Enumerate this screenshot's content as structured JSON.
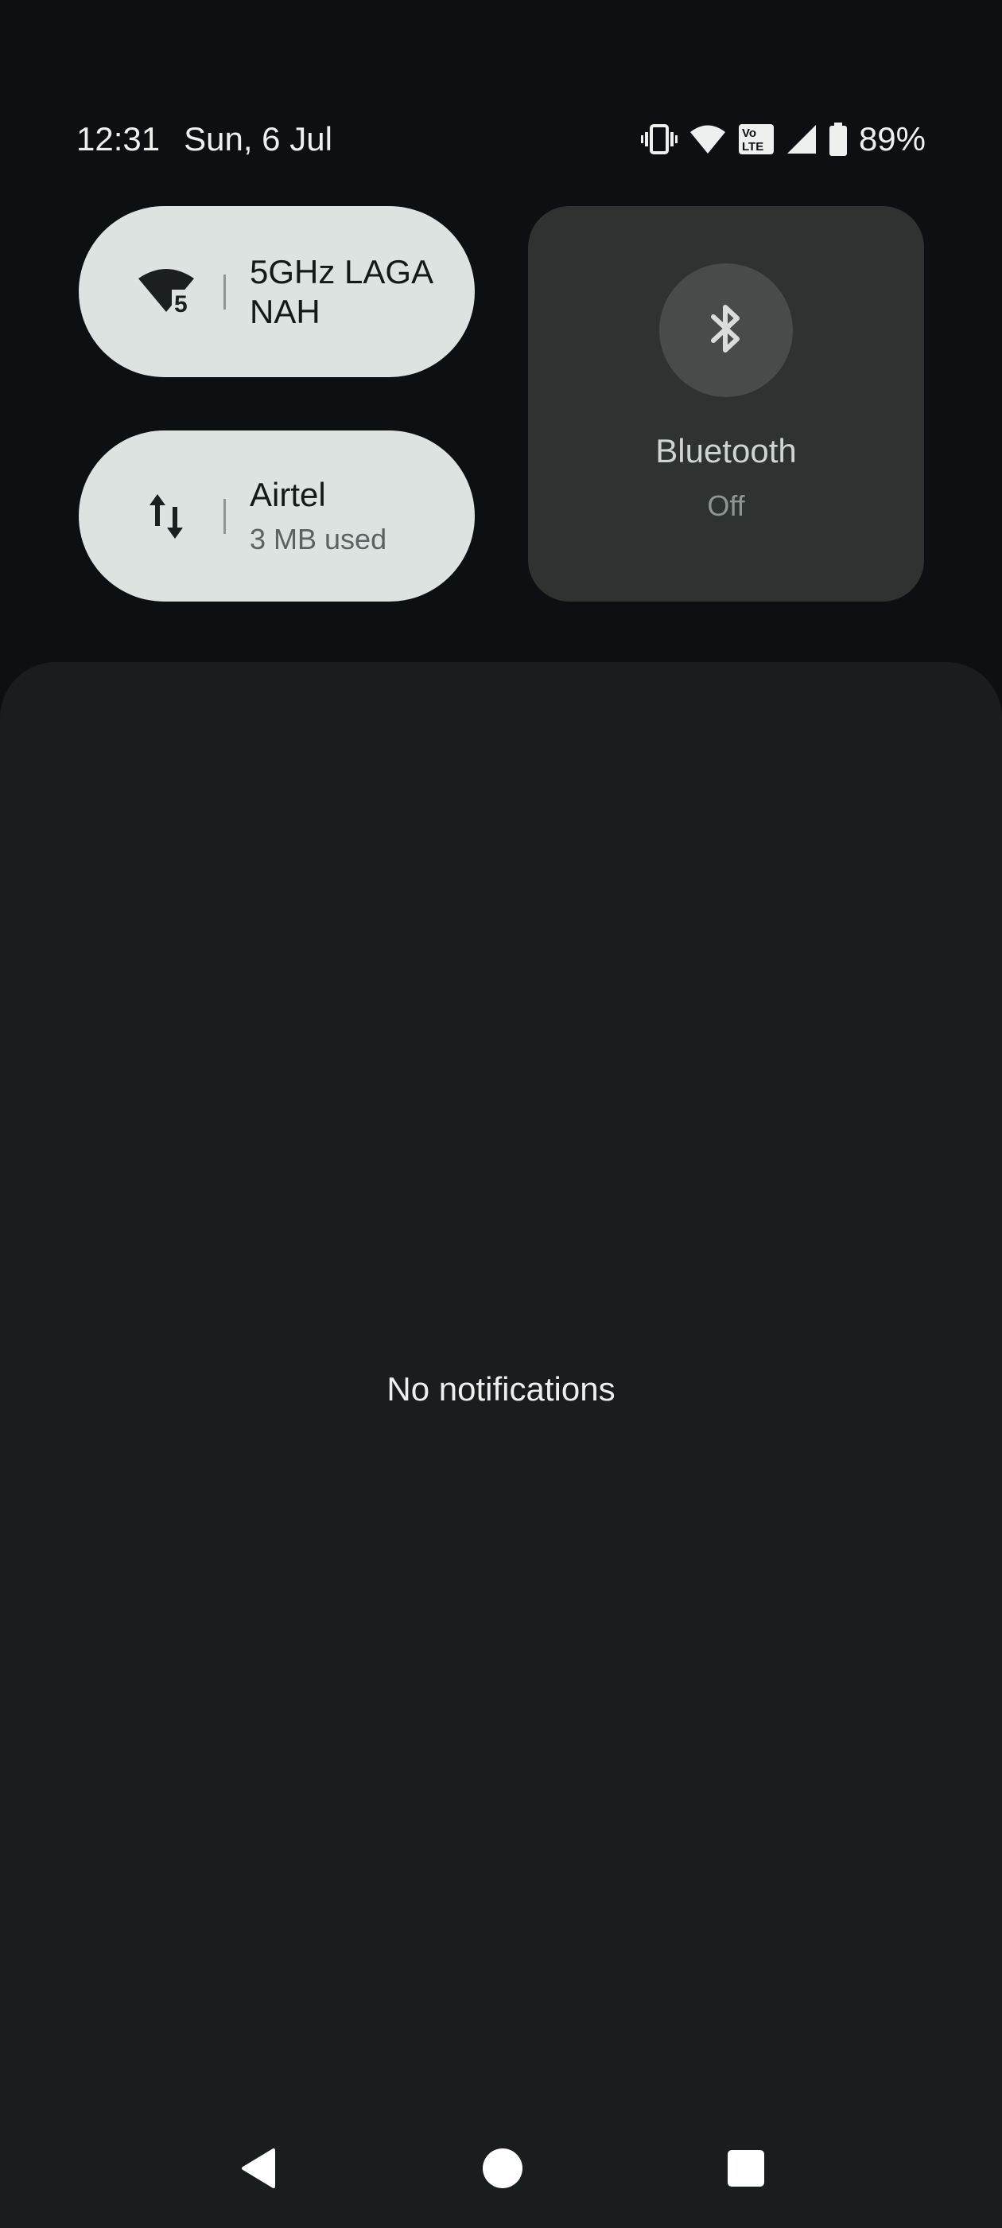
{
  "status_bar": {
    "time": "12:31",
    "date": "Sun, 6 Jul",
    "battery_percent": "89%",
    "volte_label_top": "Vo",
    "volte_label_bottom": "LTE",
    "icons": [
      "vibrate-icon",
      "wifi-signal-icon",
      "volte-icon",
      "cell-signal-icon",
      "battery-icon"
    ]
  },
  "quick_settings": {
    "wifi": {
      "title_line1": "5GHz LAGA",
      "title_line2": "NAH",
      "badge": "5",
      "icon": "wifi-icon"
    },
    "mobile_data": {
      "title": "Airtel",
      "subtitle": "3 MB used",
      "icon": "data-transfer-icon"
    },
    "bluetooth": {
      "label": "Bluetooth",
      "state": "Off",
      "icon": "bluetooth-icon"
    }
  },
  "notifications": {
    "empty_text": "No notifications"
  },
  "navigation": {
    "buttons": [
      "back-icon",
      "home-icon",
      "recents-icon"
    ]
  },
  "colors": {
    "background": "#0c1012",
    "tile_active": "#dde3e1",
    "tile_inactive": "#2e3231",
    "panel": "#191d1d"
  }
}
